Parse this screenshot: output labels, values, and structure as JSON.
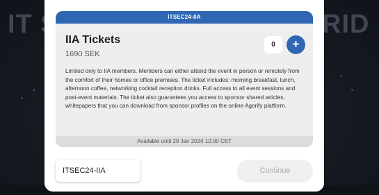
{
  "background": {
    "left_text": "IT S",
    "right_text": "RID"
  },
  "modal": {
    "header": "ITSEC24-IIA",
    "ticket": {
      "name": "IIA Tickets",
      "price": "1690 SEK",
      "quantity": "0",
      "add_icon": "plus-icon",
      "description": "Limited only to IIA members. Members can either attend the event in person or remotely from the comfort of their homes or office premises. The ticket includes: morning breakfast, lunch, afternoon coffee, networking cocktail reception drinks. Full access to all event sessions and post-event materials. The ticket also guarantees you access to sponsor shared articles, whitepapers that you can download from sponsor profiles on the online Agorify platform.",
      "availability": "Available until 29 Jan 2024 12:00 CET"
    },
    "promo_code": "ITSEC24-IIA",
    "continue_label": "Continue"
  },
  "colors": {
    "accent": "#2f67b4",
    "card_bg": "#eeeeee",
    "disabled_text": "#a9a9a9"
  }
}
